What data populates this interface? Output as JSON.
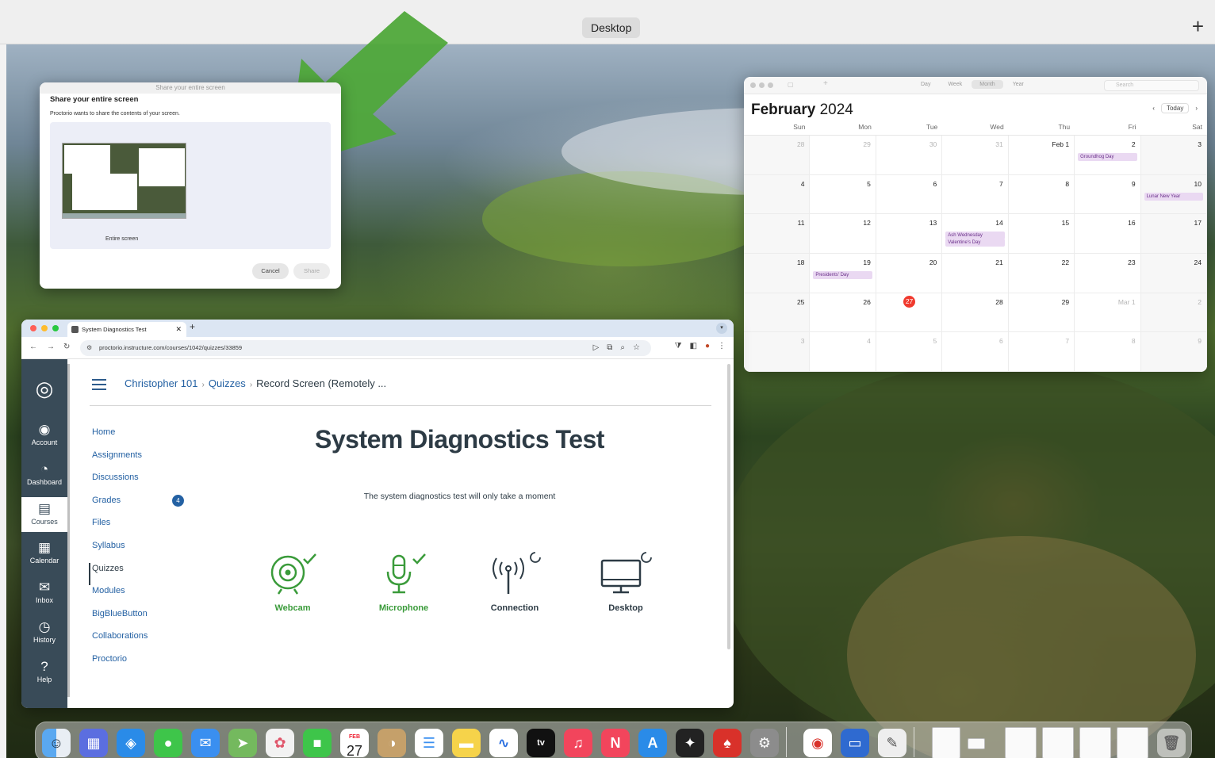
{
  "mission_control": {
    "desktop_label": "Desktop",
    "add_label": "+"
  },
  "share_dialog": {
    "header": "Share your entire screen",
    "title": "Share your entire screen",
    "description": "Proctorio wants to share the contents of your screen.",
    "thumbnail_label": "Entire screen",
    "cancel_label": "Cancel",
    "share_label": "Share"
  },
  "calendar": {
    "month": "February",
    "year": "2024",
    "view_options": [
      "Day",
      "Week",
      "Month",
      "Year"
    ],
    "active_view": "Month",
    "search_placeholder": "Search",
    "today_label": "Today",
    "weekdays": [
      "Sun",
      "Mon",
      "Tue",
      "Wed",
      "Thu",
      "Fri",
      "Sat"
    ],
    "weeks": [
      [
        {
          "d": "28",
          "dim": true
        },
        {
          "d": "29",
          "dim": true
        },
        {
          "d": "30",
          "dim": true
        },
        {
          "d": "31",
          "dim": true
        },
        {
          "d": "Feb 1"
        },
        {
          "d": "2",
          "events": [
            "Groundhog Day"
          ]
        },
        {
          "d": "3"
        }
      ],
      [
        {
          "d": "4"
        },
        {
          "d": "5"
        },
        {
          "d": "6"
        },
        {
          "d": "7"
        },
        {
          "d": "8"
        },
        {
          "d": "9"
        },
        {
          "d": "10",
          "events": [
            "Lunar New Year"
          ]
        }
      ],
      [
        {
          "d": "11"
        },
        {
          "d": "12"
        },
        {
          "d": "13"
        },
        {
          "d": "14",
          "events": [
            "Ash Wednesday",
            "Valentine's Day"
          ]
        },
        {
          "d": "15"
        },
        {
          "d": "16"
        },
        {
          "d": "17"
        }
      ],
      [
        {
          "d": "18"
        },
        {
          "d": "19",
          "events": [
            "Presidents' Day"
          ]
        },
        {
          "d": "20"
        },
        {
          "d": "21"
        },
        {
          "d": "22"
        },
        {
          "d": "23"
        },
        {
          "d": "24"
        }
      ],
      [
        {
          "d": "25"
        },
        {
          "d": "26"
        },
        {
          "d": "27",
          "today": true
        },
        {
          "d": "28"
        },
        {
          "d": "29"
        },
        {
          "d": "Mar 1",
          "dim": true
        },
        {
          "d": "2",
          "dim": true
        }
      ],
      [
        {
          "d": "3",
          "dim": true
        },
        {
          "d": "4",
          "dim": true
        },
        {
          "d": "5",
          "dim": true
        },
        {
          "d": "6",
          "dim": true
        },
        {
          "d": "7",
          "dim": true
        },
        {
          "d": "8",
          "dim": true
        },
        {
          "d": "9",
          "dim": true
        }
      ]
    ]
  },
  "browser": {
    "tab_title": "System Diagnostics Test",
    "url": "proctorio.instructure.com/courses/1042/quizzes/33859",
    "lms_nav": [
      {
        "label": "Account",
        "icon": "◉"
      },
      {
        "label": "Dashboard",
        "icon": "◔"
      },
      {
        "label": "Courses",
        "icon": "▤"
      },
      {
        "label": "Calendar",
        "icon": "▦"
      },
      {
        "label": "Inbox",
        "icon": "✉"
      },
      {
        "label": "History",
        "icon": "◷"
      },
      {
        "label": "Help",
        "icon": "?"
      }
    ],
    "breadcrumb": {
      "course": "Christopher 101",
      "section": "Quizzes",
      "current": "Record Screen (Remotely ..."
    },
    "course_nav": [
      "Home",
      "Assignments",
      "Discussions",
      "Grades",
      "Files",
      "Syllabus",
      "Quizzes",
      "Modules",
      "BigBlueButton",
      "Collaborations",
      "Proctorio"
    ],
    "active_course_nav": "Quizzes",
    "page_title": "System Diagnostics Test",
    "subtitle": "The system diagnostics test will only take a moment",
    "checks": [
      {
        "label": "Webcam",
        "status": "ok"
      },
      {
        "label": "Microphone",
        "status": "ok"
      },
      {
        "label": "Connection",
        "status": "pending"
      },
      {
        "label": "Desktop",
        "status": "pending"
      }
    ]
  },
  "dock": {
    "calendar_day": "27",
    "calendar_month": "FEB",
    "tv_label": "tv"
  },
  "colors": {
    "canvas_nav": "#394b58",
    "link": "#2461a3",
    "success": "#3a9b3a",
    "today": "#f03a2e",
    "event": "#ead9f2"
  }
}
